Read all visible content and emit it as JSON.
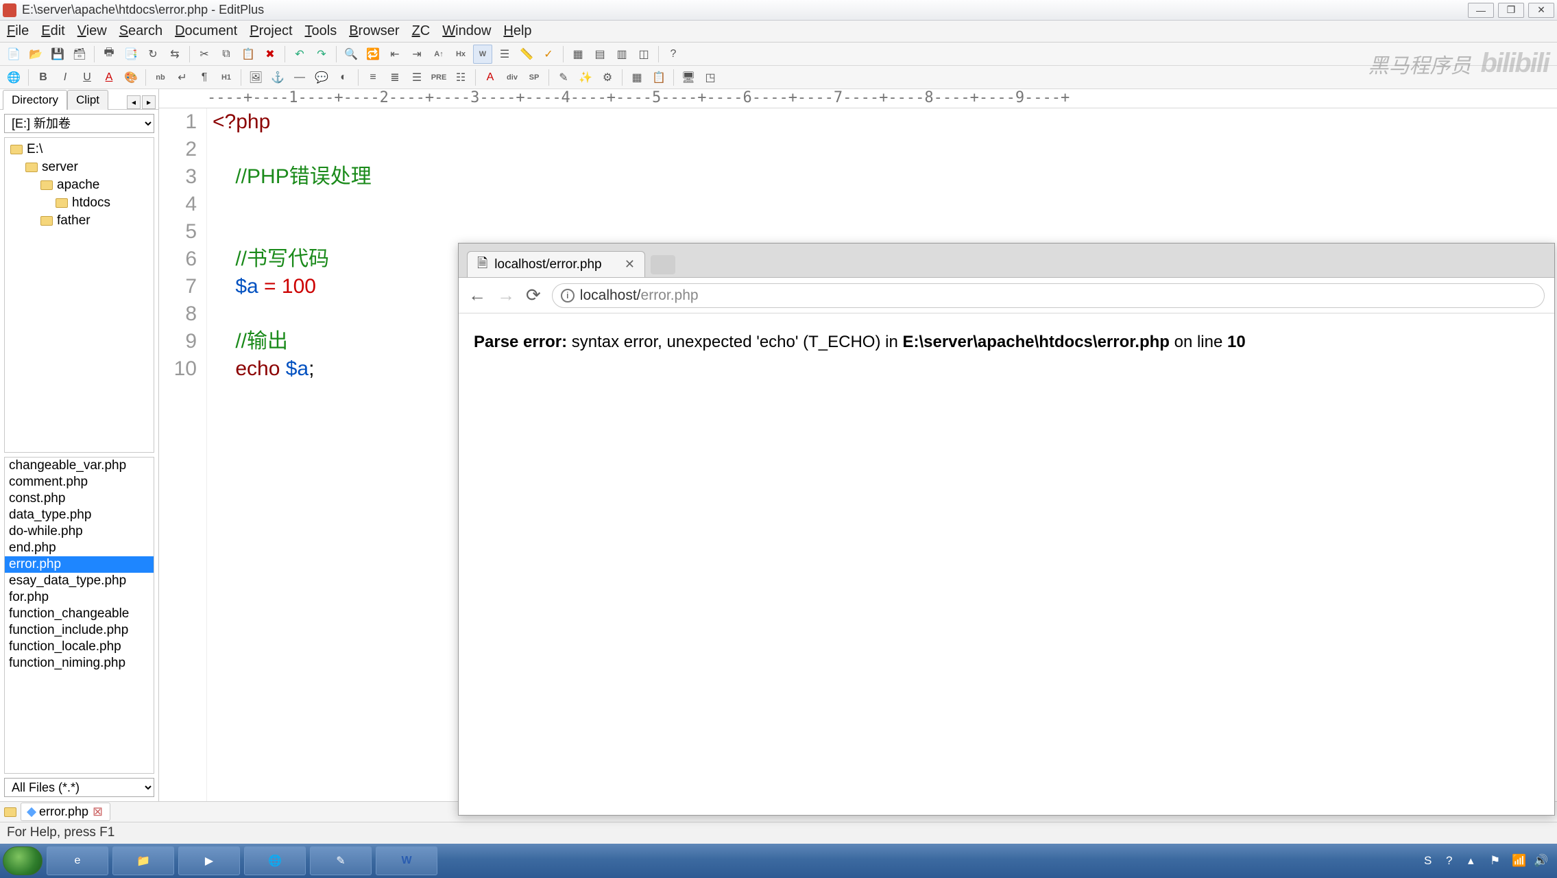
{
  "window": {
    "title": "E:\\server\\apache\\htdocs\\error.php - EditPlus"
  },
  "menu": [
    "File",
    "Edit",
    "View",
    "Search",
    "Document",
    "Project",
    "Tools",
    "Browser",
    "ZC",
    "Window",
    "Help"
  ],
  "sidebar": {
    "tabs": [
      "Directory",
      "Clipt"
    ],
    "drive": "[E:] 新加卷",
    "tree": [
      {
        "indent": 0,
        "label": "E:\\"
      },
      {
        "indent": 1,
        "label": "server"
      },
      {
        "indent": 2,
        "label": "apache"
      },
      {
        "indent": 3,
        "label": "htdocs"
      },
      {
        "indent": 2,
        "label": "father"
      }
    ],
    "files": [
      "changeable_var.php",
      "comment.php",
      "const.php",
      "data_type.php",
      "do-while.php",
      "end.php",
      "error.php",
      "esay_data_type.php",
      "for.php",
      "function_changeable",
      "function_include.php",
      "function_locale.php",
      "function_niming.php"
    ],
    "selected_file": "error.php",
    "filter": "All Files (*.*)"
  },
  "ruler": "----+----1----+----2----+----3----+----4----+----5----+----6----+----7----+----8----+----9----+",
  "code": {
    "lines": [
      {
        "n": "1",
        "parts": [
          {
            "t": "<?php",
            "c": "kw"
          }
        ]
      },
      {
        "n": "2",
        "parts": []
      },
      {
        "n": "3",
        "parts": [
          {
            "t": "    ",
            "c": ""
          },
          {
            "t": "//PHP错误处理",
            "c": "cm"
          }
        ]
      },
      {
        "n": "4",
        "parts": []
      },
      {
        "n": "5",
        "parts": []
      },
      {
        "n": "6",
        "parts": [
          {
            "t": "    ",
            "c": ""
          },
          {
            "t": "//书写代码",
            "c": "cm"
          }
        ]
      },
      {
        "n": "7",
        "parts": [
          {
            "t": "    ",
            "c": ""
          },
          {
            "t": "$a",
            "c": "var"
          },
          {
            "t": " = ",
            "c": "op"
          },
          {
            "t": "100",
            "c": "num"
          }
        ]
      },
      {
        "n": "8",
        "parts": []
      },
      {
        "n": "9",
        "parts": [
          {
            "t": "    ",
            "c": ""
          },
          {
            "t": "//输出",
            "c": "cm"
          }
        ]
      },
      {
        "n": "10",
        "parts": [
          {
            "t": "    ",
            "c": ""
          },
          {
            "t": "echo ",
            "c": "kw"
          },
          {
            "t": "$a",
            "c": "var"
          },
          {
            "t": ";",
            "c": ""
          }
        ]
      }
    ]
  },
  "doctab": {
    "label": "error.php"
  },
  "statusbar": "For Help, press F1",
  "browser": {
    "tab_title": "localhost/error.php",
    "url_host": "localhost/",
    "url_path": "error.php",
    "error_prefix": "Parse error:",
    "error_mid": " syntax error, unexpected 'echo' (T_ECHO) in ",
    "error_file": "E:\\server\\apache\\htdocs\\error.php",
    "error_suffix": " on line ",
    "error_line": "10"
  },
  "watermark": "黑马程序员",
  "bilibili": "bilibili"
}
